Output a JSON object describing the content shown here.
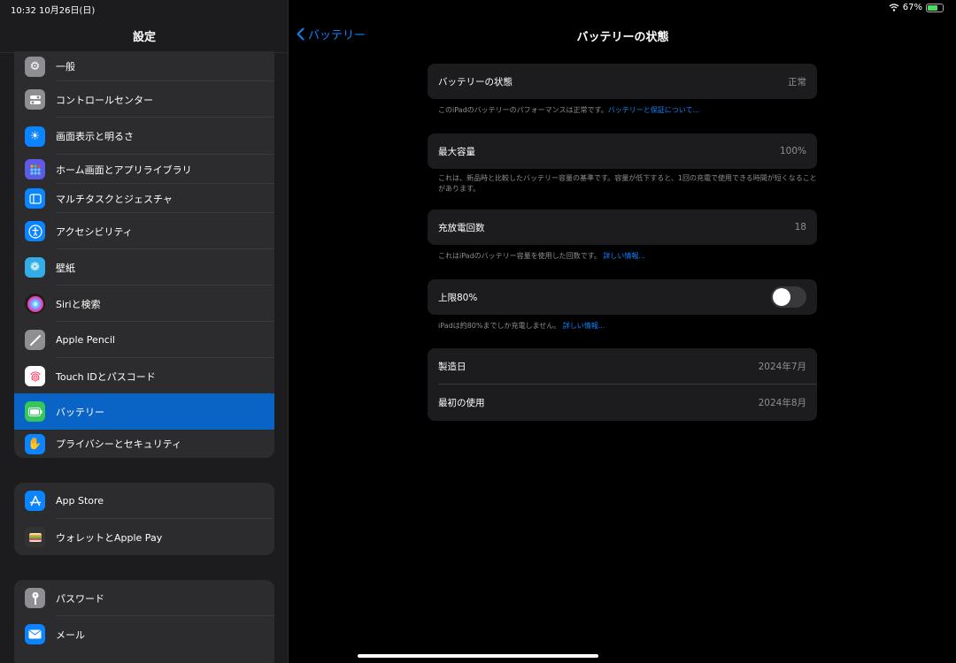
{
  "status": {
    "time_date": "10:32  10月26日(日)",
    "battery_pct": "67%",
    "battery_level": 0.67
  },
  "sidebar": {
    "title": "設定",
    "group1": [
      {
        "label": "一般",
        "icon": "gear-icon",
        "color": "#8e8e93"
      },
      {
        "label": "コントロールセンター",
        "icon": "switches-icon",
        "color": "#8e8e93"
      },
      {
        "label": "画面表示と明るさ",
        "icon": "sun-icon",
        "color": "#0a84ff"
      },
      {
        "label": "ホーム画面とアプリライブラリ",
        "icon": "grid-icon",
        "color": "#5e5ce6"
      },
      {
        "label": "マルチタスクとジェスチャ",
        "icon": "multitask-icon",
        "color": "#0a84ff"
      },
      {
        "label": "アクセシビリティ",
        "icon": "accessibility-icon",
        "color": "#0a84ff"
      },
      {
        "label": "壁紙",
        "icon": "flower-icon",
        "color": "#32ade6"
      },
      {
        "label": "Siriと検索",
        "icon": "siri-icon",
        "color": "#222222"
      },
      {
        "label": "Apple Pencil",
        "icon": "pencil-icon",
        "color": "#8e8e93"
      },
      {
        "label": "Touch IDとパスコード",
        "icon": "fingerprint-icon",
        "color": "#ffffff"
      },
      {
        "label": "バッテリー",
        "icon": "battery-icon",
        "color": "#34c759"
      },
      {
        "label": "プライバシーとセキュリティ",
        "icon": "hand-icon",
        "color": "#0a84ff"
      }
    ],
    "group2": [
      {
        "label": "App Store",
        "icon": "appstore-icon",
        "color": "#0a84ff"
      },
      {
        "label": "ウォレットとApple Pay",
        "icon": "wallet-icon",
        "color": "#333333"
      }
    ],
    "group3": [
      {
        "label": "パスワード",
        "icon": "key-icon",
        "color": "#8e8e93"
      },
      {
        "label": "メール",
        "icon": "mail-icon",
        "color": "#0a84ff"
      }
    ]
  },
  "detail": {
    "back_label": "バッテリー",
    "title": "バッテリーの状態",
    "health": {
      "label": "バッテリーの状態",
      "value": "正常"
    },
    "health_note": "このiPadのバッテリーのパフォーマンスは正常です。",
    "health_link": "バッテリーと保証について...",
    "capacity": {
      "label": "最大容量",
      "value": "100%"
    },
    "capacity_note": "これは、新品時と比較したバッテリー容量の基準です。容量が低下すると、1回の充電で使用できる時間が短くなることがあります。",
    "cycles": {
      "label": "充放電回数",
      "value": "18"
    },
    "cycles_note": "これはiPadのバッテリー容量を使用した回数です。",
    "cycles_link": "詳しい情報...",
    "limit": {
      "label": "上限80%",
      "on": false
    },
    "limit_note": "iPadは約80%までしか充電しません。",
    "limit_link": "詳しい情報...",
    "manufactured": {
      "label": "製造日",
      "value": "2024年7月"
    },
    "first_use": {
      "label": "最初の使用",
      "value": "2024年8月"
    }
  }
}
